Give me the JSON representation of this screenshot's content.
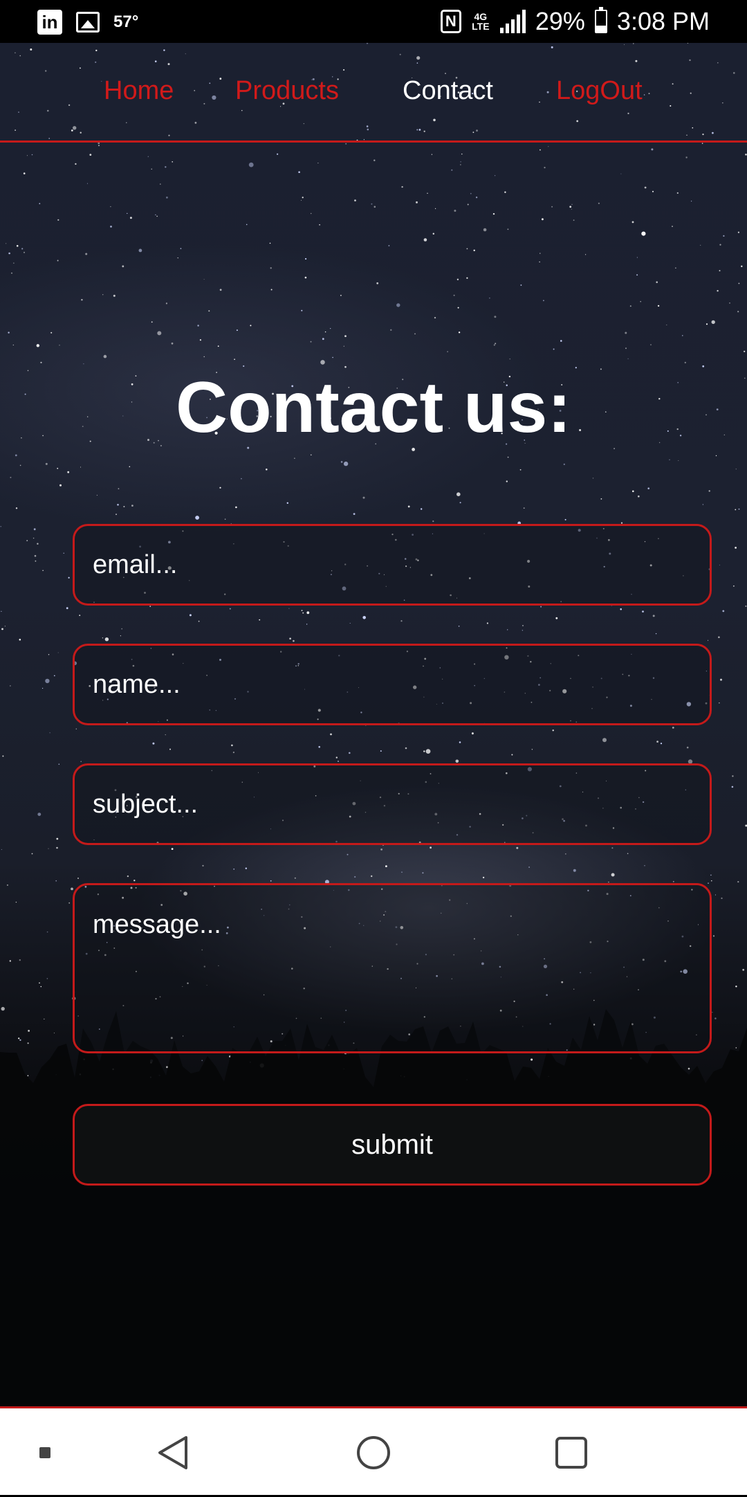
{
  "status_bar": {
    "temperature": "57°",
    "battery_percent": "29%",
    "battery_level": 0.29,
    "time": "3:08 PM",
    "nfc_label": "N",
    "network_label": "4G LTE",
    "icons": [
      "linkedin-icon",
      "image-icon",
      "nfc-icon",
      "lte-icon",
      "signal-icon",
      "battery-icon"
    ]
  },
  "nav": {
    "items": [
      {
        "label": "Home",
        "active": false
      },
      {
        "label": "Products",
        "active": false
      },
      {
        "label": "Contact",
        "active": true
      },
      {
        "label": "LogOut",
        "active": false
      }
    ]
  },
  "page": {
    "title": "Contact us:"
  },
  "form": {
    "email_placeholder": "email...",
    "name_placeholder": "name...",
    "subject_placeholder": "subject...",
    "message_placeholder": "message...",
    "submit_label": "submit"
  },
  "colors": {
    "accent": "#c41a1a",
    "nav_inactive": "#d11a1a",
    "nav_active": "#ffffff",
    "text": "#ffffff"
  },
  "bottom_nav": {
    "icons": [
      "recent-dot-icon",
      "back-icon",
      "home-icon",
      "overview-icon"
    ]
  }
}
